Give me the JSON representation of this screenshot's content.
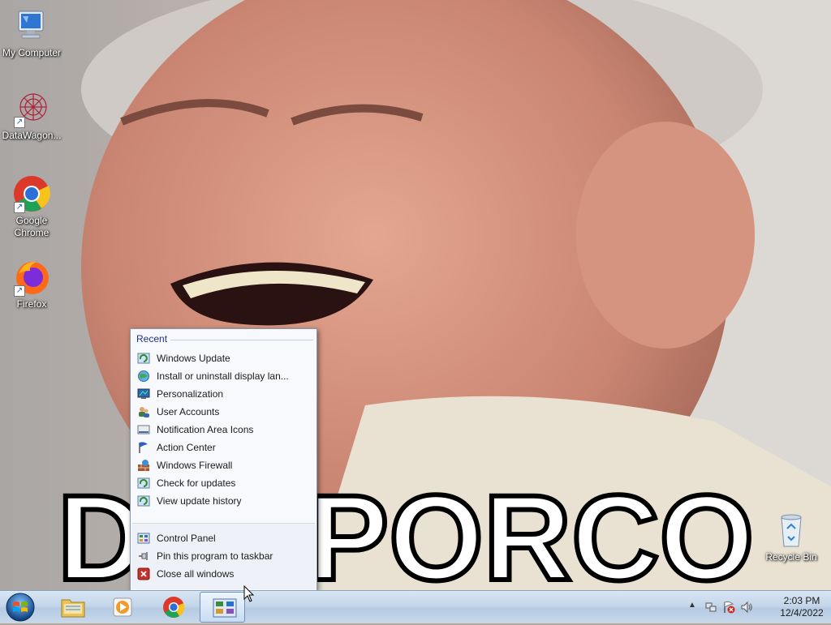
{
  "desktop": {
    "icons": [
      {
        "label": "My Computer",
        "icon": "computer-icon"
      },
      {
        "label": "DataWagon...",
        "icon": "datawagon-icon"
      },
      {
        "label": "Google Chrome",
        "icon": "chrome-icon"
      },
      {
        "label": "Firefox",
        "icon": "firefox-icon"
      },
      {
        "label": "Recycle Bin",
        "icon": "recycle-bin-icon"
      }
    ],
    "wallpaper_text": "DIO PORCO"
  },
  "jumplist": {
    "section": "Recent",
    "recent": [
      {
        "label": "Windows Update",
        "icon": "windows-update-icon"
      },
      {
        "label": "Install or uninstall display lan...",
        "icon": "display-language-icon"
      },
      {
        "label": "Personalization",
        "icon": "personalization-icon"
      },
      {
        "label": "User Accounts",
        "icon": "user-accounts-icon"
      },
      {
        "label": "Notification Area Icons",
        "icon": "notification-area-icon"
      },
      {
        "label": "Action Center",
        "icon": "action-center-flag-icon"
      },
      {
        "label": "Windows Firewall",
        "icon": "firewall-icon"
      },
      {
        "label": "Check for updates",
        "icon": "windows-update-icon"
      },
      {
        "label": "View update history",
        "icon": "windows-update-icon"
      }
    ],
    "tasks": [
      {
        "label": "Control Panel",
        "icon": "control-panel-icon"
      },
      {
        "label": "Pin this program to taskbar",
        "icon": "pin-icon"
      },
      {
        "label": "Close all windows",
        "icon": "close-icon"
      }
    ]
  },
  "taskbar": {
    "pinned": [
      {
        "name": "explorer",
        "icon": "folder-icon"
      },
      {
        "name": "media-player",
        "icon": "media-player-icon"
      },
      {
        "name": "chrome",
        "icon": "chrome-icon"
      },
      {
        "name": "control-panel",
        "icon": "control-panel-icon",
        "active": true
      }
    ],
    "clock": {
      "time": "2:03 PM",
      "date": "12/4/2022"
    }
  },
  "colors": {
    "header": "#1e3287",
    "taskbar": "#c4d6ea",
    "close_red": "#c4302b"
  }
}
